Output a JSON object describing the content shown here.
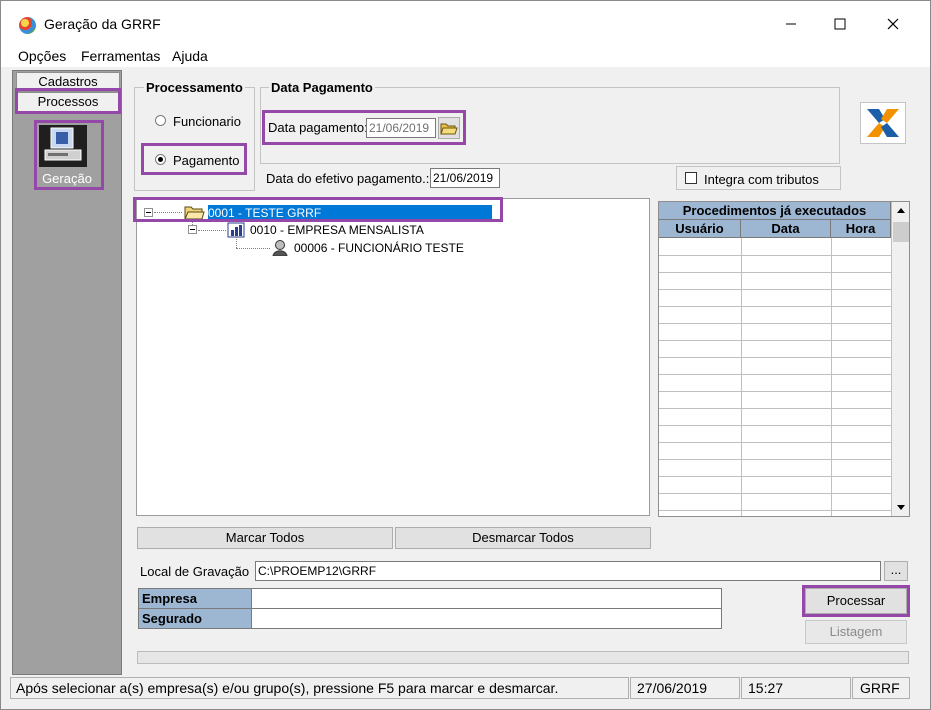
{
  "window": {
    "title": "Geração da GRRF"
  },
  "menu": {
    "items": [
      "Opções",
      "Ferramentas",
      "Ajuda"
    ]
  },
  "left_panel": {
    "tabs": [
      "Cadastros",
      "Processos"
    ],
    "geracao_label": "Geração"
  },
  "processamento": {
    "title": "Processamento",
    "options": [
      "Funcionario",
      "Pagamento"
    ],
    "selected": "Pagamento"
  },
  "data_pagamento": {
    "title": "Data Pagamento",
    "label": "Data pagamento:",
    "value": "21/06/2019"
  },
  "efetivo": {
    "label": "Data do efetivo pagamento.:",
    "value": "21/06/2019"
  },
  "integra": {
    "label": "Integra com tributos",
    "checked": false
  },
  "tree": {
    "items": [
      {
        "label": "0001 - TESTE GRRF",
        "level": 0,
        "selected": true
      },
      {
        "label": "0010 - EMPRESA MENSALISTA",
        "level": 1,
        "selected": false
      },
      {
        "label": "00006 - FUNCIONÁRIO TESTE",
        "level": 2,
        "selected": false
      }
    ]
  },
  "procedimentos": {
    "title": "Procedimentos já executados",
    "columns": [
      "Usuário",
      "Data",
      "Hora"
    ],
    "rows": []
  },
  "buttons": {
    "marcar_todos": "Marcar Todos",
    "desmarcar_todos": "Desmarcar Todos",
    "processar": "Processar",
    "listagem": "Listagem",
    "browse": "..."
  },
  "local_gravacao": {
    "label": "Local de Gravação",
    "value": "C:\\PROEMP12\\GRRF"
  },
  "info": {
    "empresa_label": "Empresa",
    "segurado_label": "Segurado",
    "empresa_value": "",
    "segurado_value": ""
  },
  "status": {
    "message": "Após selecionar a(s) empresa(s) e/ou grupo(s), pressione F5 para marcar e desmarcar.",
    "date": "27/06/2019",
    "time": "15:27",
    "module": "GRRF"
  },
  "colors": {
    "highlight": "#9448a8",
    "selection": "#0078d7",
    "table_header": "#9db6d2",
    "panel": "#a0a0a0"
  }
}
